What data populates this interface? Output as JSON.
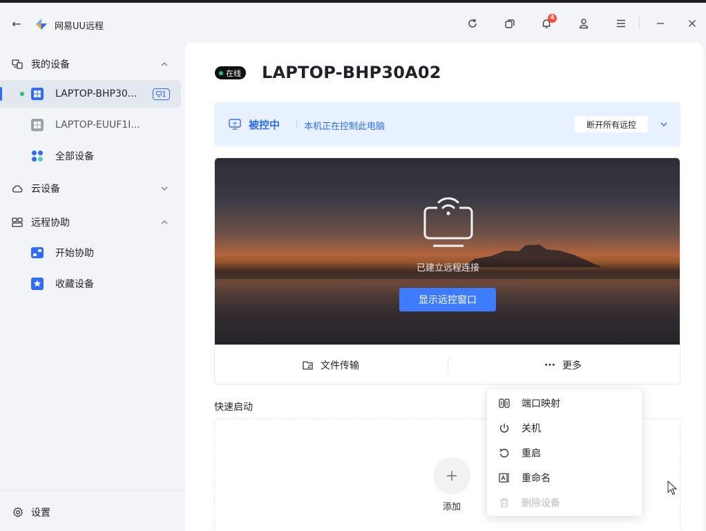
{
  "app": {
    "title": "网易UU远程",
    "badge_count": "4"
  },
  "sidebar": {
    "my_devices": {
      "label": "我的设备"
    },
    "devices": [
      {
        "label": "LAPTOP-BHP30...",
        "badge": "1",
        "status": "online",
        "active": true
      },
      {
        "label": "LAPTOP-EUUF1I...",
        "active": false
      }
    ],
    "all_devices": "全部设备",
    "cloud_devices": {
      "label": "云设备"
    },
    "remote_assist": {
      "label": "远程协助"
    },
    "start_assist": "开始协助",
    "favorites": "收藏设备",
    "settings": "设置"
  },
  "device": {
    "status_label": "在线",
    "name": "LAPTOP-BHP30A02"
  },
  "banner": {
    "label": "被控中",
    "description": "本机正在控制此电脑",
    "disconnect_button": "断开所有远控"
  },
  "hero": {
    "connection_text": "已建立远程连接",
    "show_window_button": "显示远控窗口"
  },
  "actions": {
    "file_transfer": "文件传输",
    "more": "更多",
    "more_dots": "···"
  },
  "quick_launch": {
    "title": "快速启动",
    "add_label": "添加"
  },
  "menu": {
    "items": [
      {
        "label": "端口映射",
        "icon": "port-mapping-icon",
        "disabled": false
      },
      {
        "label": "关机",
        "icon": "power-icon",
        "disabled": false
      },
      {
        "label": "重启",
        "icon": "restart-icon",
        "disabled": false
      },
      {
        "label": "重命名",
        "icon": "rename-icon",
        "disabled": false
      },
      {
        "label": "删除设备",
        "icon": "trash-icon",
        "disabled": true
      }
    ]
  },
  "colors": {
    "accent": "#2f6bff",
    "online": "#1cc46b",
    "badge": "#ff4d3b",
    "banner_bg": "#e8f1ff"
  }
}
